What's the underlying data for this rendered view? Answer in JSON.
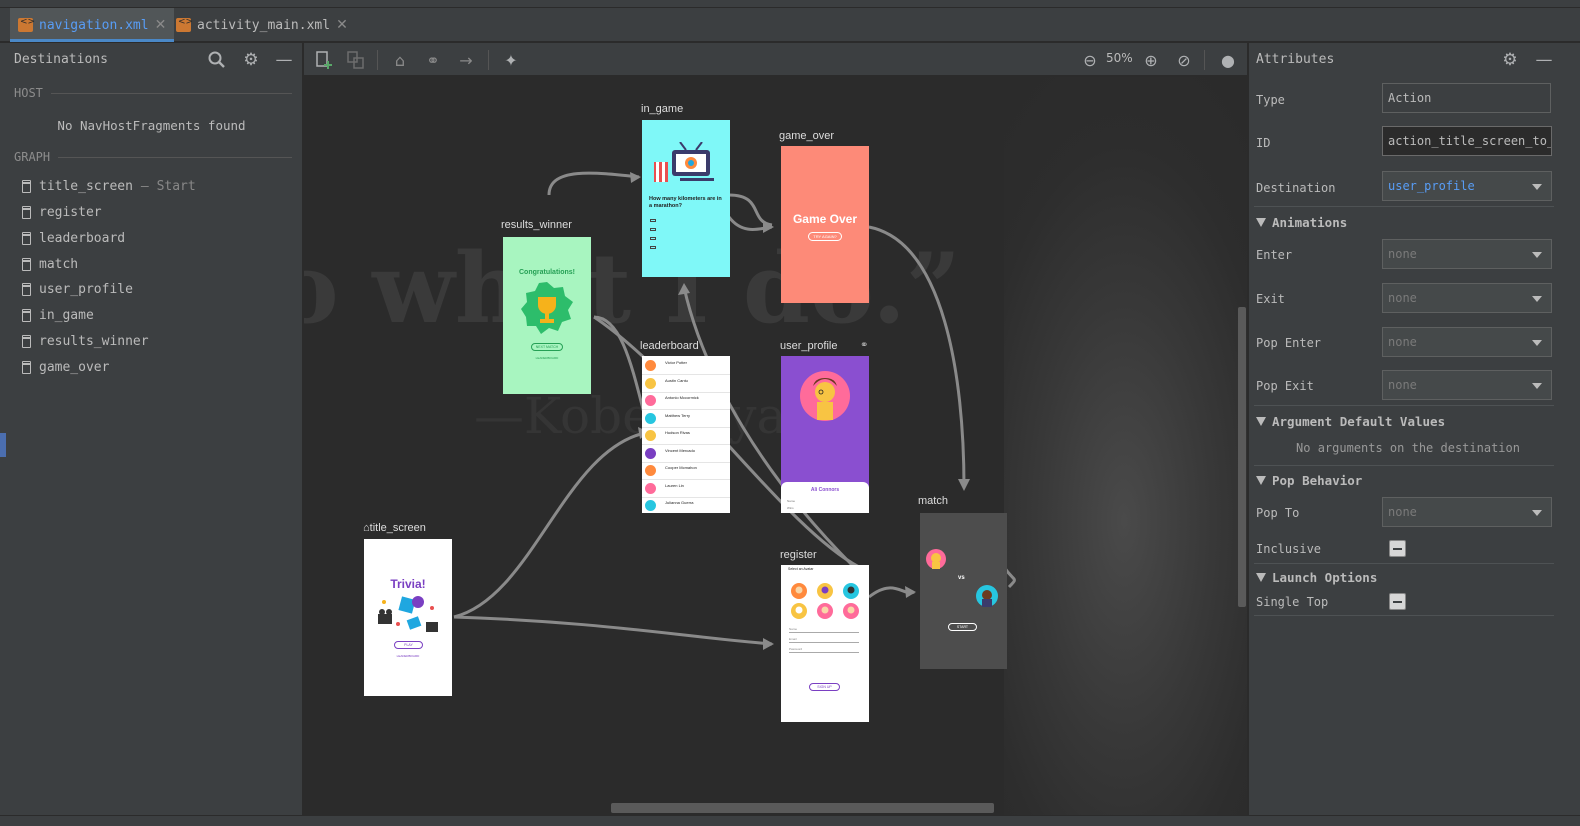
{
  "tabs": [
    {
      "label": "navigation.xml",
      "active": true
    },
    {
      "label": "activity_main.xml",
      "active": false
    }
  ],
  "destinations_panel": {
    "title": "Destinations",
    "host_section": "HOST",
    "host_empty": "No NavHostFragments found",
    "graph_section": "GRAPH",
    "start_suffix": "— Start",
    "items": [
      "title_screen",
      "register",
      "leaderboard",
      "match",
      "user_profile",
      "in_game",
      "results_winner",
      "game_over"
    ]
  },
  "toolbar": {
    "zoom": "50%"
  },
  "background_art": {
    "quote": "“I do what I do.”",
    "author": "—Kobe Bryant"
  },
  "graph": {
    "nodes": {
      "in_game": {
        "label": "in_game",
        "question": "How many kilometers are in a marathon?"
      },
      "game_over": {
        "label": "game_over",
        "title": "Game Over",
        "button": "TRY AGAIN?"
      },
      "results_winner": {
        "label": "results_winner",
        "title": "Congratulations!",
        "button": "NEXT MATCH",
        "link": "LEADERBOARD"
      },
      "leaderboard": {
        "label": "leaderboard",
        "rows": [
          "Victor Potter",
          "Austin Cantu",
          "Antonio Mccormick",
          "Matthew Terry",
          "Hudson Rivas",
          "Vincent Mercado",
          "Cooper Mcmahon",
          "Lauren Lin",
          "Julianna Guerra"
        ]
      },
      "user_profile": {
        "label": "user_profile",
        "name": "Ali Connors",
        "fields": [
          "Name",
          "Wins"
        ]
      },
      "match": {
        "label": "match",
        "vs": "vs",
        "button": "START"
      },
      "title_screen": {
        "label": "title_screen",
        "title": "Trivia!",
        "button": "PLAY",
        "link": "LEADERBOARD"
      },
      "register": {
        "label": "register",
        "heading": "Select an Avatar",
        "fields": [
          "Name",
          "Email",
          "Password"
        ],
        "button": "SIGN UP"
      }
    }
  },
  "attributes_panel": {
    "title": "Attributes",
    "type_label": "Type",
    "type_value": "Action",
    "id_label": "ID",
    "id_value": "action_title_screen_to_",
    "destination_label": "Destination",
    "destination_value": "user_profile",
    "animations_section": "Animations",
    "enter_label": "Enter",
    "enter_value": "none",
    "exit_label": "Exit",
    "exit_value": "none",
    "pop_enter_label": "Pop Enter",
    "pop_enter_value": "none",
    "pop_exit_label": "Pop Exit",
    "pop_exit_value": "none",
    "args_section": "Argument Default Values",
    "args_empty": "No arguments on the destination",
    "pop_section": "Pop Behavior",
    "pop_to_label": "Pop To",
    "pop_to_value": "none",
    "inclusive_label": "Inclusive",
    "launch_section": "Launch Options",
    "single_top_label": "Single Top"
  },
  "colors": {
    "accent": "#589df6",
    "in_game_bg": "#7ff8f8",
    "game_over_bg": "#fd8a78",
    "results_bg": "#a8f5c0",
    "profile_bg": "#8a4fd0"
  }
}
